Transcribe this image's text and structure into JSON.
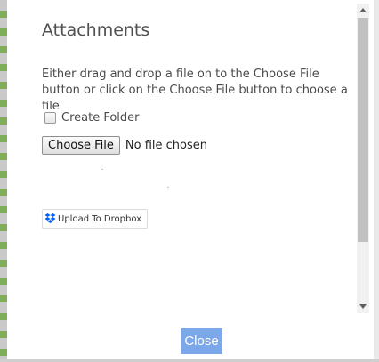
{
  "dialog": {
    "title": "Attachments",
    "instructions": "Either drag and drop a file on to the Choose File button or click on the Choose File button to choose a file",
    "create_folder_label": "Create Folder",
    "create_folder_checked": false,
    "choose_file_label": "Choose File",
    "file_status": "No file chosen",
    "dropbox_label": "Upload To Dropbox",
    "dropbox_icon": "dropbox-icon",
    "close_label": "Close"
  },
  "colors": {
    "close_button_bg": "#7ca7e8",
    "dropbox_blue": "#0061fe",
    "text": "#4a4a4a"
  }
}
